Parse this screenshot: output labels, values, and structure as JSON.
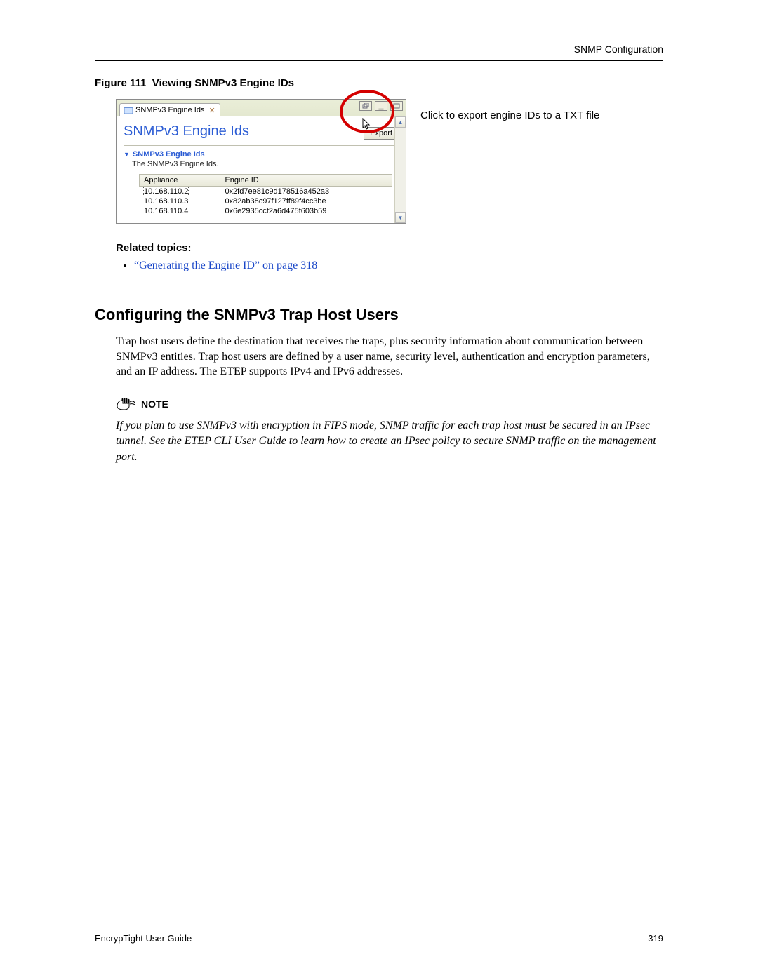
{
  "header": {
    "section_title": "SNMP Configuration"
  },
  "figure": {
    "label": "Figure 111",
    "caption": "Viewing SNMPv3 Engine IDs",
    "callout": "Click to export engine IDs to a TXT file"
  },
  "window": {
    "tab_label": "SNMPv3 Engine Ids",
    "panel_title": "SNMPv3 Engine Ids",
    "export_label": "Export",
    "section_title": "SNMPv3 Engine Ids",
    "section_desc": "The SNMPv3 Engine Ids.",
    "table": {
      "col_appliance": "Appliance",
      "col_engine": "Engine ID",
      "rows": [
        {
          "appliance": "10.168.110.2",
          "engine": "0x2fd7ee81c9d178516a452a3"
        },
        {
          "appliance": "10.168.110.3",
          "engine": "0x82ab38c97f127ff89f4cc3be"
        },
        {
          "appliance": "10.168.110.4",
          "engine": "0x6e2935ccf2a6d475f603b59"
        }
      ]
    }
  },
  "related": {
    "heading": "Related topics:",
    "items": [
      {
        "text": "“Generating the Engine ID” on page 318"
      }
    ]
  },
  "subsection": {
    "heading": "Configuring the SNMPv3 Trap Host Users",
    "para": "Trap host users define the destination that receives the traps, plus security information about communication between SNMPv3 entities. Trap host users are defined by a user name, security level, authentication and encryption parameters, and an IP address. The ETEP supports IPv4 and IPv6 addresses."
  },
  "note": {
    "label": "NOTE",
    "body": "If you plan to use SNMPv3 with encryption in FIPS mode, SNMP traffic for each trap host must be secured in an IPsec tunnel. See the ETEP CLI User Guide to learn how to create an IPsec policy to secure SNMP traffic on the management port."
  },
  "footer": {
    "guide": "EncrypTight User Guide",
    "page": "319"
  }
}
